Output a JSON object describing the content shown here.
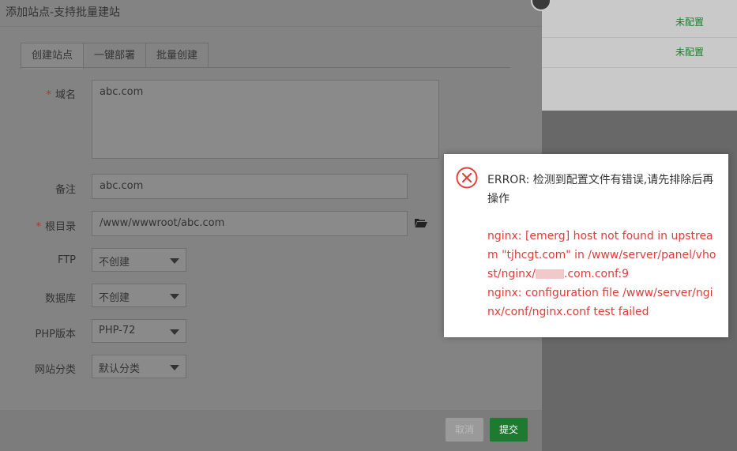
{
  "background": {
    "rows": [
      {
        "status": "未配置"
      },
      {
        "status": "未配置"
      }
    ]
  },
  "dialog": {
    "title": "添加站点-支持批量建站",
    "tabs": [
      "创建站点",
      "一键部署",
      "批量创建"
    ],
    "form": {
      "domain": {
        "label": "域名",
        "value": "abc.com"
      },
      "note": {
        "label": "备注",
        "value": "abc.com"
      },
      "root": {
        "label": "根目录",
        "value": "/www/wwwroot/abc.com"
      },
      "ftp": {
        "label": "FTP",
        "value": "不创建"
      },
      "database": {
        "label": "数据库",
        "value": "不创建"
      },
      "php": {
        "label": "PHP版本",
        "value": "PHP-72"
      },
      "category": {
        "label": "网站分类",
        "value": "默认分类"
      }
    },
    "buttons": {
      "cancel": "取消",
      "submit": "提交"
    }
  },
  "error": {
    "heading": "ERROR: 检测到配置文件有错误,请先排除后再操作",
    "detail_line1": "nginx: [emerg] host not found in upstream \"tjhcgt.com\" in /www/server/panel/vhost/nginx/",
    "detail_line1_end": ".com.conf:9",
    "detail_line2": "nginx: configuration file /www/server/nginx/conf/nginx.conf test failed"
  },
  "colors": {
    "accent": "#1f7a31",
    "error": "#e03b3b",
    "status": "#1d7f2e"
  }
}
